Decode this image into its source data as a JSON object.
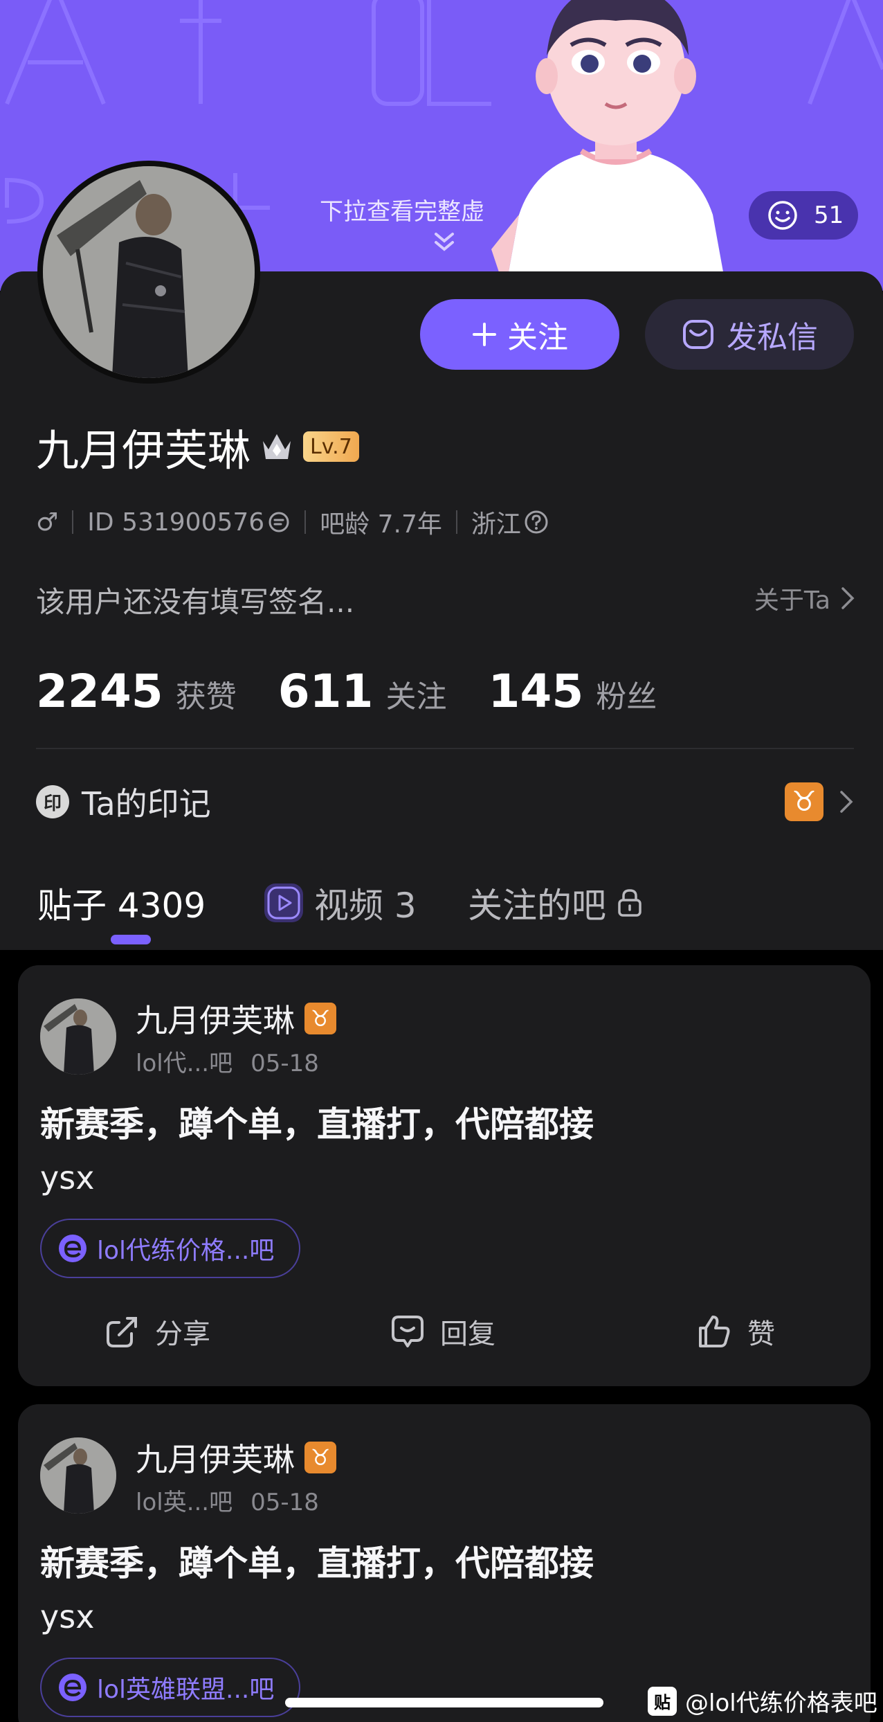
{
  "header": {
    "pull_hint": "下拉查看完整虚",
    "mood_count": "51"
  },
  "profile": {
    "follow_label": "关注",
    "follow_icon": "plus-icon",
    "message_label": "发私信",
    "message_icon": "envelope-icon",
    "username": "九月伊芙琳",
    "level": "Lv.7",
    "gender_symbol": "♂",
    "user_id": "ID 531900576",
    "bar_age": "吧龄 7.7年",
    "location": "浙江",
    "signature": "该用户还没有填写签名...",
    "about_label": "关于Ta",
    "stats": [
      {
        "num": "2245",
        "label": "获赞"
      },
      {
        "num": "611",
        "label": "关注"
      },
      {
        "num": "145",
        "label": "粉丝"
      }
    ],
    "mark_badge": "印",
    "mark_label": "Ta的印记",
    "zodiac_symbol": "♉"
  },
  "tabs": [
    {
      "label": "贴子 4309",
      "active": true
    },
    {
      "label": "视频 3",
      "active": false
    },
    {
      "label": "关注的吧",
      "active": false
    }
  ],
  "posts": [
    {
      "author": "九月伊芙琳",
      "zodiac": "♉",
      "forum_short": "lol代...吧",
      "date": "05-18",
      "title": "新赛季，蹲个单，直播打，代陪都接",
      "body": "ysx",
      "forum_tag": "lol代练价格...吧",
      "share": "分享",
      "reply": "回复",
      "like": "赞"
    },
    {
      "author": "九月伊芙琳",
      "zodiac": "♉",
      "forum_short": "lol英...吧",
      "date": "05-18",
      "title": "新赛季，蹲个单，直播打，代陪都接",
      "body": "ysx",
      "forum_tag": "lol英雄联盟...吧"
    }
  ],
  "watermark": {
    "logo": "贴",
    "text": "@lol代练价格表吧"
  },
  "colors": {
    "banner": "#7a5cf7",
    "accent": "#7b61ff",
    "card": "#1c1c1e",
    "background": "#000000",
    "zodiac_chip": "#e88a2e"
  }
}
